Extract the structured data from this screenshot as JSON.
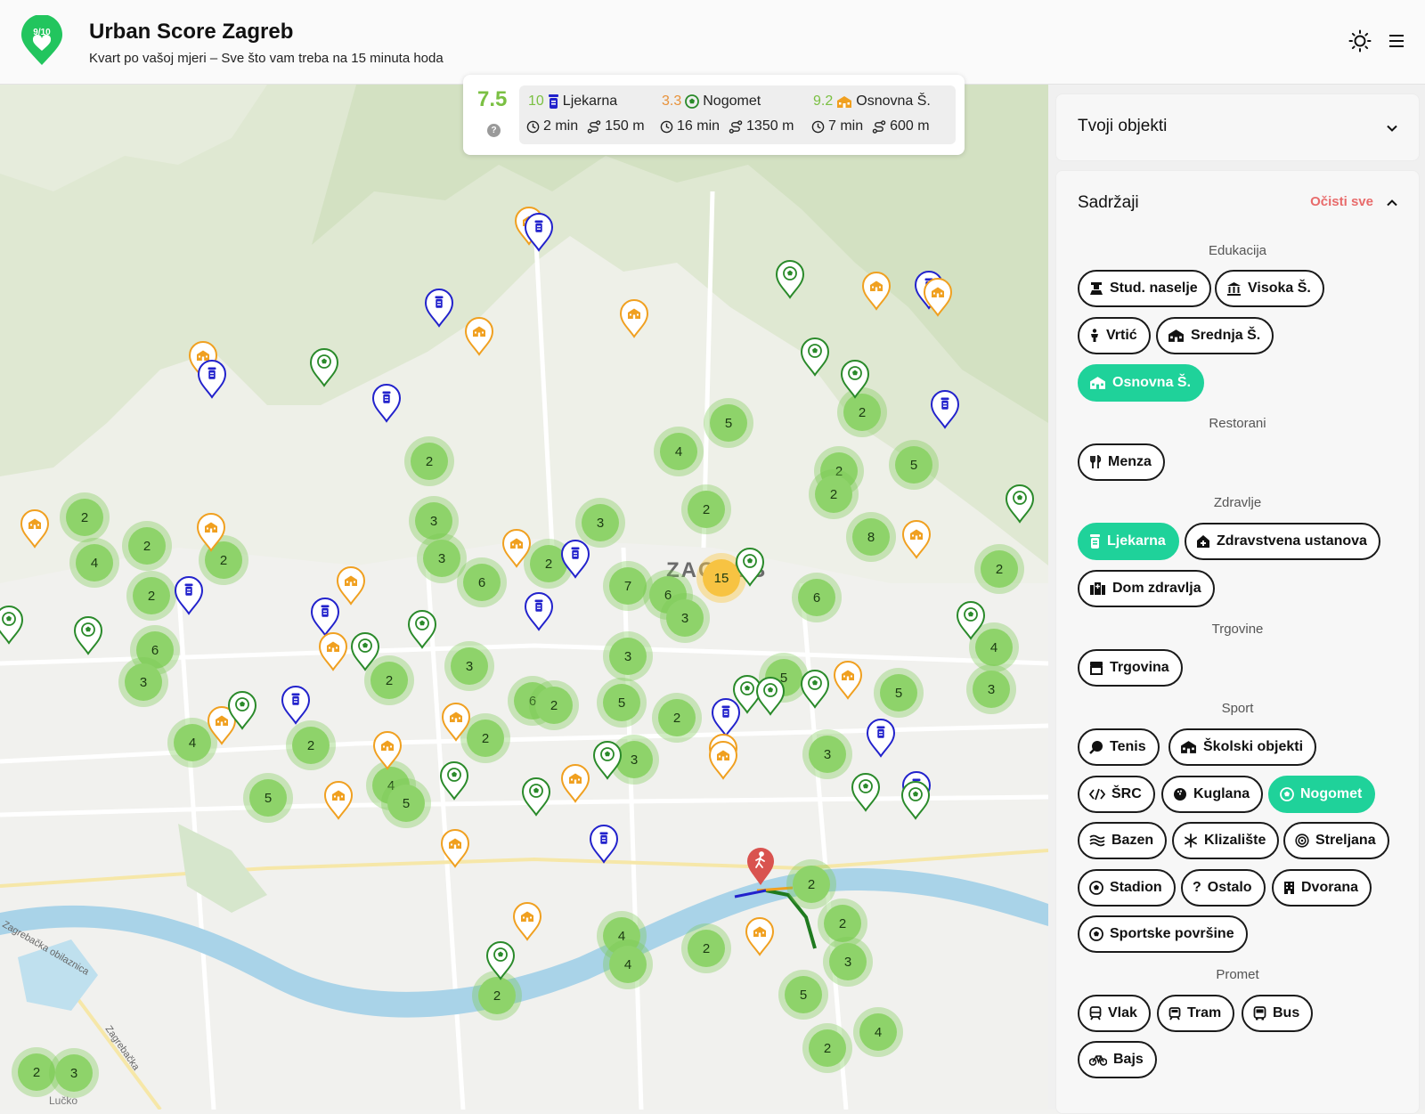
{
  "header": {
    "logo_text": "9/10",
    "title": "Urban Score Zagreb",
    "subtitle": "Kvart po vašoj mjeri – Sve što vam treba na 15 minuta hoda",
    "theme_icon": "sun-icon",
    "menu_icon": "hamburger-menu-icon"
  },
  "score": {
    "total": "7.5",
    "help": "?",
    "items": [
      {
        "score": "10",
        "score_color": "#7bc043",
        "icon": "pharmacy-icon",
        "label": "Ljekarna",
        "time": "2 min",
        "distance": "150 m"
      },
      {
        "score": "3.3",
        "score_color": "#e8923a",
        "icon": "football-icon",
        "label": "Nogomet",
        "time": "16 min",
        "distance": "1350 m"
      },
      {
        "score": "9.2",
        "score_color": "#7bc043",
        "icon": "school-icon",
        "label": "Osnovna Š.",
        "time": "7 min",
        "distance": "600 m"
      }
    ]
  },
  "map": {
    "city_label": "ZAGREB",
    "labels": [
      "Lučko",
      "Zagrebačka obilaznica",
      "Zagrebačka"
    ]
  },
  "sidebar": {
    "objects_panel": {
      "title": "Tvoji objekti"
    },
    "content_panel": {
      "title": "Sadržaji",
      "clear_all": "Očisti sve",
      "categories": [
        {
          "name": "Edukacija",
          "chips": [
            {
              "label": "Stud. naselje",
              "icon": "dorm-icon",
              "active": false
            },
            {
              "label": "Visoka Š.",
              "icon": "university-icon",
              "active": false
            },
            {
              "label": "Vrtić",
              "icon": "child-icon",
              "active": false
            },
            {
              "label": "Srednja Š.",
              "icon": "school-icon",
              "active": false
            },
            {
              "label": "Osnovna Š.",
              "icon": "school-icon",
              "active": true
            }
          ]
        },
        {
          "name": "Restorani",
          "chips": [
            {
              "label": "Menza",
              "icon": "cutlery-icon",
              "active": false
            }
          ]
        },
        {
          "name": "Zdravlje",
          "chips": [
            {
              "label": "Ljekarna",
              "icon": "pharmacy-icon",
              "active": true
            },
            {
              "label": "Zdravstvena ustanova",
              "icon": "clinic-icon",
              "active": false
            },
            {
              "label": "Dom zdravlja",
              "icon": "hospital-icon",
              "active": false
            }
          ]
        },
        {
          "name": "Trgovine",
          "chips": [
            {
              "label": "Trgovina",
              "icon": "store-icon",
              "active": false
            }
          ]
        },
        {
          "name": "Sport",
          "chips": [
            {
              "label": "Tenis",
              "icon": "tennis-icon",
              "active": false
            },
            {
              "label": "Školski objekti",
              "icon": "school-icon",
              "active": false
            },
            {
              "label": "ŠRC",
              "icon": "code-icon",
              "active": false
            },
            {
              "label": "Kuglana",
              "icon": "bowling-icon",
              "active": false
            },
            {
              "label": "Nogomet",
              "icon": "football-icon",
              "active": true
            },
            {
              "label": "Bazen",
              "icon": "waves-icon",
              "active": false
            },
            {
              "label": "Klizalište",
              "icon": "snowflake-icon",
              "active": false
            },
            {
              "label": "Streljana",
              "icon": "target-icon",
              "active": false
            },
            {
              "label": "Stadion",
              "icon": "football-icon",
              "active": false
            },
            {
              "label": "Ostalo",
              "icon": "question-icon",
              "active": false
            },
            {
              "label": "Dvorana",
              "icon": "building-icon",
              "active": false
            },
            {
              "label": "Sportske površine",
              "icon": "football-icon",
              "active": false
            }
          ]
        },
        {
          "name": "Promet",
          "chips": [
            {
              "label": "Vlak",
              "icon": "train-icon",
              "active": false
            },
            {
              "label": "Tram",
              "icon": "tram-icon",
              "active": false
            },
            {
              "label": "Bus",
              "icon": "bus-icon",
              "active": false
            },
            {
              "label": "Bajs",
              "icon": "bike-icon",
              "active": false
            }
          ]
        }
      ]
    }
  },
  "colors": {
    "accent": "#1fd29a",
    "cluster": "#8ed36a",
    "pharmacy_pin": "#2222cc",
    "school_pin": "#f0a020",
    "football_pin": "#2a8a2a",
    "clear": "#e86b6b"
  },
  "clusters": [
    "5",
    "4",
    "2",
    "2",
    "5",
    "2",
    "2",
    "3",
    "3",
    "3",
    "2",
    "6",
    "2",
    "8",
    "2",
    "2",
    "4",
    "2",
    "2",
    "7",
    "6",
    "3",
    "6",
    "15",
    "2",
    "6",
    "4",
    "3",
    "3",
    "2",
    "3",
    "6",
    "2",
    "5",
    "5",
    "5",
    "4",
    "2",
    "2",
    "2",
    "3",
    "3",
    "3",
    "5",
    "4",
    "5",
    "2",
    "2",
    "3",
    "4",
    "2",
    "4",
    "5",
    "2",
    "4",
    "2",
    "2",
    "3"
  ],
  "pins": [
    "school",
    "pharmacy",
    "pharmacy",
    "school",
    "school",
    "football",
    "school",
    "school",
    "pharmacy",
    "football",
    "school",
    "pharmacy",
    "pharmacy",
    "football",
    "football",
    "pharmacy",
    "school",
    "school",
    "school",
    "pharmacy",
    "football",
    "school",
    "football",
    "football",
    "school",
    "pharmacy",
    "football",
    "school",
    "football",
    "pharmacy",
    "football",
    "football",
    "pharmacy",
    "school",
    "football",
    "pharmacy",
    "school",
    "school",
    "school",
    "football",
    "football",
    "pharmacy",
    "football",
    "football",
    "school",
    "pharmacy",
    "school",
    "school",
    "football",
    "pharmacy",
    "football",
    "football",
    "school",
    "football",
    "school",
    "pharmacy",
    "football",
    "school",
    "school"
  ],
  "user_marker": "walking-person-icon"
}
